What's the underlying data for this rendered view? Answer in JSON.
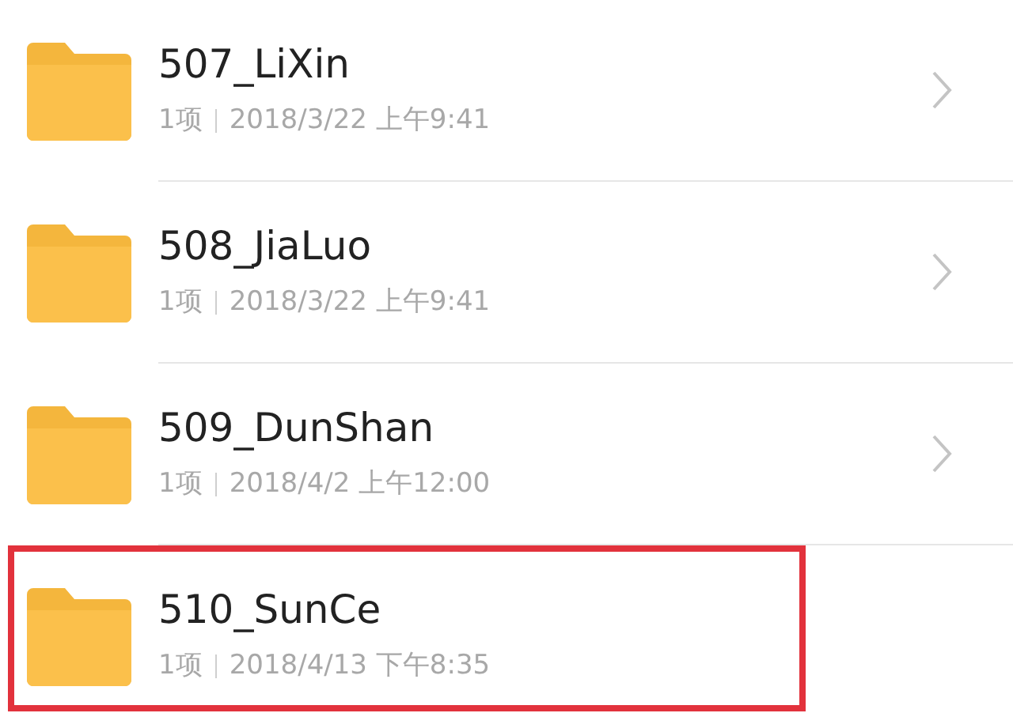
{
  "folders": [
    {
      "name": "507_LiXin",
      "count": "1项",
      "date": "2018/3/22 上午9:41",
      "highlighted": false,
      "chevron": true
    },
    {
      "name": "508_JiaLuo",
      "count": "1项",
      "date": "2018/3/22 上午9:41",
      "highlighted": false,
      "chevron": true
    },
    {
      "name": "509_DunShan",
      "count": "1项",
      "date": "2018/4/2 上午12:00",
      "highlighted": false,
      "chevron": true
    },
    {
      "name": "510_SunCe",
      "count": "1项",
      "date": "2018/4/13 下午8:35",
      "highlighted": true,
      "chevron": false
    }
  ]
}
